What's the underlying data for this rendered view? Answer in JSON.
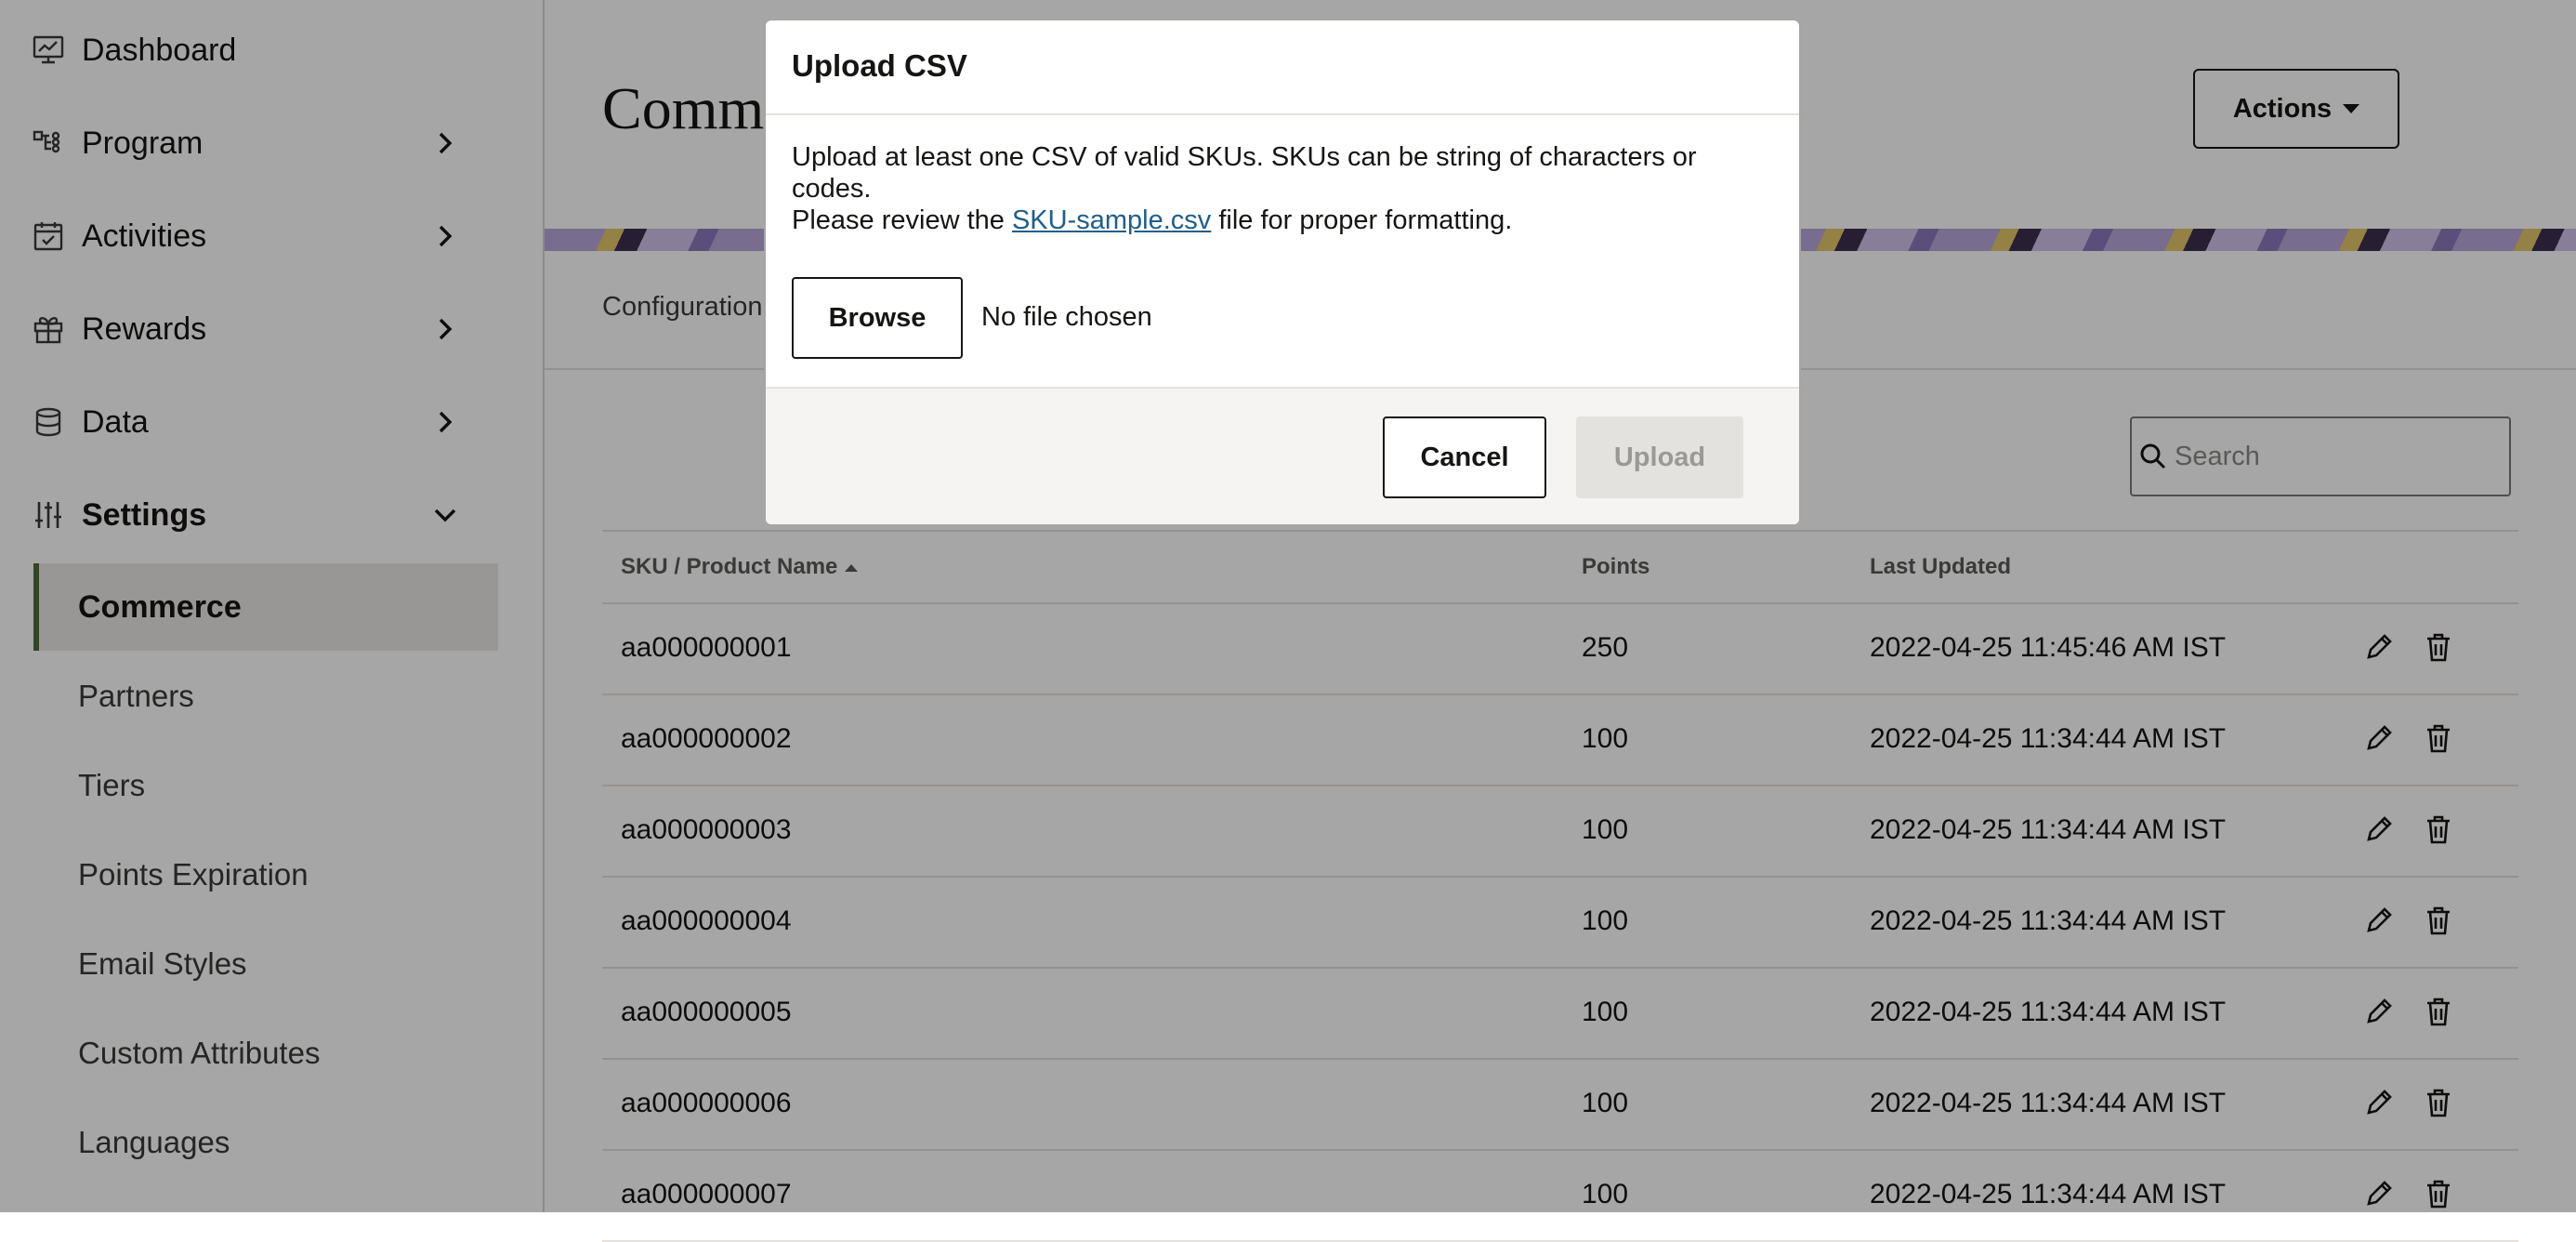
{
  "sidebar": {
    "items": [
      {
        "label": "Dashboard",
        "icon": "monitor-chart-icon"
      },
      {
        "label": "Program",
        "icon": "program-icon"
      },
      {
        "label": "Activities",
        "icon": "calendar-check-icon"
      },
      {
        "label": "Rewards",
        "icon": "gift-icon"
      },
      {
        "label": "Data",
        "icon": "database-icon"
      },
      {
        "label": "Settings",
        "icon": "sliders-icon"
      }
    ],
    "settings_children": [
      "Commerce",
      "Partners",
      "Tiers",
      "Points Expiration",
      "Email Styles",
      "Custom Attributes",
      "Languages"
    ],
    "active_child": "Commerce",
    "accent_color": "#4e6b3a"
  },
  "header": {
    "title": "Comme",
    "actions_label": "Actions"
  },
  "tabs": {
    "active": "Configuration"
  },
  "search": {
    "placeholder": "Search"
  },
  "table": {
    "columns": [
      "SKU / Product Name",
      "Points",
      "Last Updated"
    ],
    "rows": [
      {
        "sku": "aa000000001",
        "points": "250",
        "updated": "2022-04-25 11:45:46 AM IST"
      },
      {
        "sku": "aa000000002",
        "points": "100",
        "updated": "2022-04-25 11:34:44 AM IST"
      },
      {
        "sku": "aa000000003",
        "points": "100",
        "updated": "2022-04-25 11:34:44 AM IST"
      },
      {
        "sku": "aa000000004",
        "points": "100",
        "updated": "2022-04-25 11:34:44 AM IST"
      },
      {
        "sku": "aa000000005",
        "points": "100",
        "updated": "2022-04-25 11:34:44 AM IST"
      },
      {
        "sku": "aa000000006",
        "points": "100",
        "updated": "2022-04-25 11:34:44 AM IST"
      },
      {
        "sku": "aa000000007",
        "points": "100",
        "updated": "2022-04-25 11:34:44 AM IST"
      }
    ]
  },
  "dialog": {
    "title": "Upload CSV",
    "body_line1": "Upload at least one CSV of valid SKUs. SKUs can be string of characters or codes.",
    "body_line2_before": "Please review the ",
    "body_link": "SKU-sample.csv",
    "body_line2_after": " file for proper formatting.",
    "browse_label": "Browse",
    "file_status": "No file chosen",
    "cancel_label": "Cancel",
    "upload_label": "Upload"
  }
}
